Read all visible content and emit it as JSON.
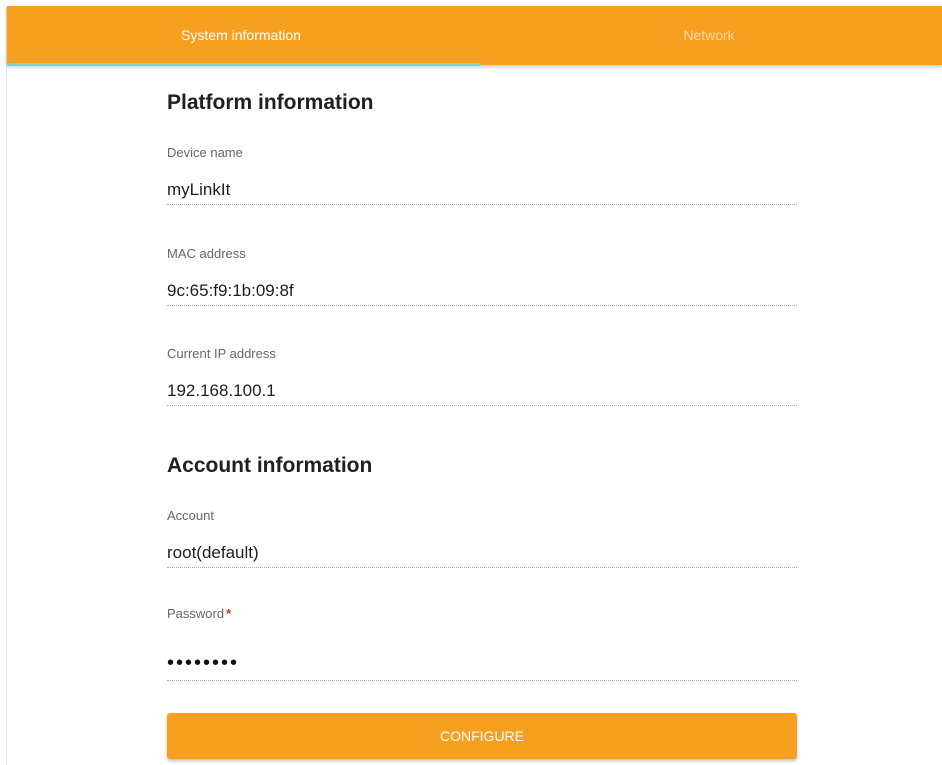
{
  "tabs": [
    {
      "label": "System information",
      "active": true
    },
    {
      "label": "Network",
      "active": false
    }
  ],
  "platform": {
    "title": "Platform information",
    "device_name": {
      "label": "Device name",
      "value": "myLinkIt"
    },
    "mac_address": {
      "label": "MAC address",
      "value": "9c:65:f9:1b:09:8f"
    },
    "current_ip": {
      "label": "Current IP address",
      "value": "192.168.100.1"
    }
  },
  "account": {
    "title": "Account information",
    "account": {
      "label": "Account",
      "value": "root(default)"
    },
    "password": {
      "label": "Password",
      "required_mark": "*",
      "value": "••••••••"
    }
  },
  "configure_label": "CONFIGURE",
  "colors": {
    "accent": "#f7a01f",
    "tab_indicator": "#7ed3d0",
    "required": "#e0301e"
  }
}
